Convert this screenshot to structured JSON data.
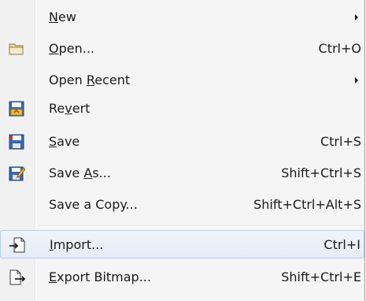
{
  "menu": {
    "items": [
      {
        "pre": "",
        "ul": "N",
        "post": "ew",
        "shortcut": "",
        "submenu": true
      },
      {
        "pre": "",
        "ul": "O",
        "post": "pen...",
        "shortcut": "Ctrl+O",
        "submenu": false
      },
      {
        "pre": "Open ",
        "ul": "R",
        "post": "ecent",
        "shortcut": "",
        "submenu": true
      },
      {
        "pre": "Re",
        "ul": "v",
        "post": "ert",
        "shortcut": "",
        "submenu": false
      },
      {
        "pre": "",
        "ul": "S",
        "post": "ave",
        "shortcut": "Ctrl+S",
        "submenu": false
      },
      {
        "pre": "Save ",
        "ul": "A",
        "post": "s...",
        "shortcut": "Shift+Ctrl+S",
        "submenu": false
      },
      {
        "pre": "Save a Copy...",
        "ul": "",
        "post": "",
        "shortcut": "Shift+Ctrl+Alt+S",
        "submenu": false
      },
      {
        "pre": "",
        "ul": "I",
        "post": "mport...",
        "shortcut": "Ctrl+I",
        "submenu": false
      },
      {
        "pre": "",
        "ul": "E",
        "post": "xport Bitmap...",
        "shortcut": "Shift+Ctrl+E",
        "submenu": false
      }
    ],
    "highlighted_item": "Import..."
  },
  "icons": {
    "open": "folder-icon",
    "revert": "revert-icon",
    "save": "save-icon",
    "save_as": "save-as-icon",
    "import": "import-icon",
    "export": "export-icon"
  },
  "colors": {
    "highlight_border": "#aecff7",
    "highlight_fill": "#e9eef6"
  }
}
